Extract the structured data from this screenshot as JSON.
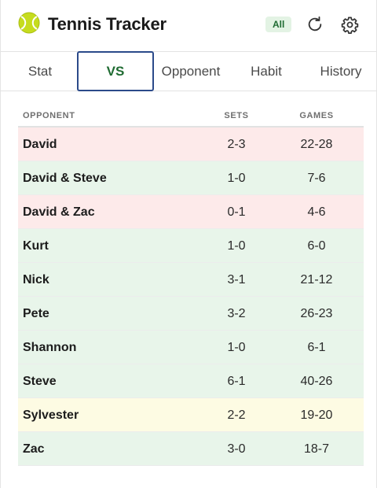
{
  "header": {
    "title": "Tennis Tracker",
    "filter_badge": "All",
    "logo_icon": "tennis-ball-icon",
    "refresh_icon": "refresh-icon",
    "settings_icon": "gear-icon"
  },
  "tabs": [
    {
      "label": "Stat",
      "active": false
    },
    {
      "label": "VS",
      "active": true
    },
    {
      "label": "Opponent",
      "active": false
    },
    {
      "label": "Habit",
      "active": false
    },
    {
      "label": "History",
      "active": false
    }
  ],
  "table": {
    "columns": {
      "opponent": "OPPONENT",
      "sets": "SETS",
      "games": "GAMES"
    },
    "rows": [
      {
        "opponent": "David",
        "sets": "2-3",
        "games": "22-28",
        "result": "loss"
      },
      {
        "opponent": "David & Steve",
        "sets": "1-0",
        "games": "7-6",
        "result": "win"
      },
      {
        "opponent": "David & Zac",
        "sets": "0-1",
        "games": "4-6",
        "result": "loss"
      },
      {
        "opponent": "Kurt",
        "sets": "1-0",
        "games": "6-0",
        "result": "win"
      },
      {
        "opponent": "Nick",
        "sets": "3-1",
        "games": "21-12",
        "result": "win"
      },
      {
        "opponent": "Pete",
        "sets": "3-2",
        "games": "26-23",
        "result": "win"
      },
      {
        "opponent": "Shannon",
        "sets": "1-0",
        "games": "6-1",
        "result": "win"
      },
      {
        "opponent": "Steve",
        "sets": "6-1",
        "games": "40-26",
        "result": "win"
      },
      {
        "opponent": "Sylvester",
        "sets": "2-2",
        "games": "19-20",
        "result": "draw"
      },
      {
        "opponent": "Zac",
        "sets": "3-0",
        "games": "18-7",
        "result": "win"
      }
    ]
  },
  "colors": {
    "accent_green": "#1f6b32",
    "active_tab_border": "#2b4a8a",
    "loss_row": "#fdeaea",
    "win_row": "#e8f5ea",
    "draw_row": "#fdfbe3",
    "ball": "#c6dc1e"
  }
}
